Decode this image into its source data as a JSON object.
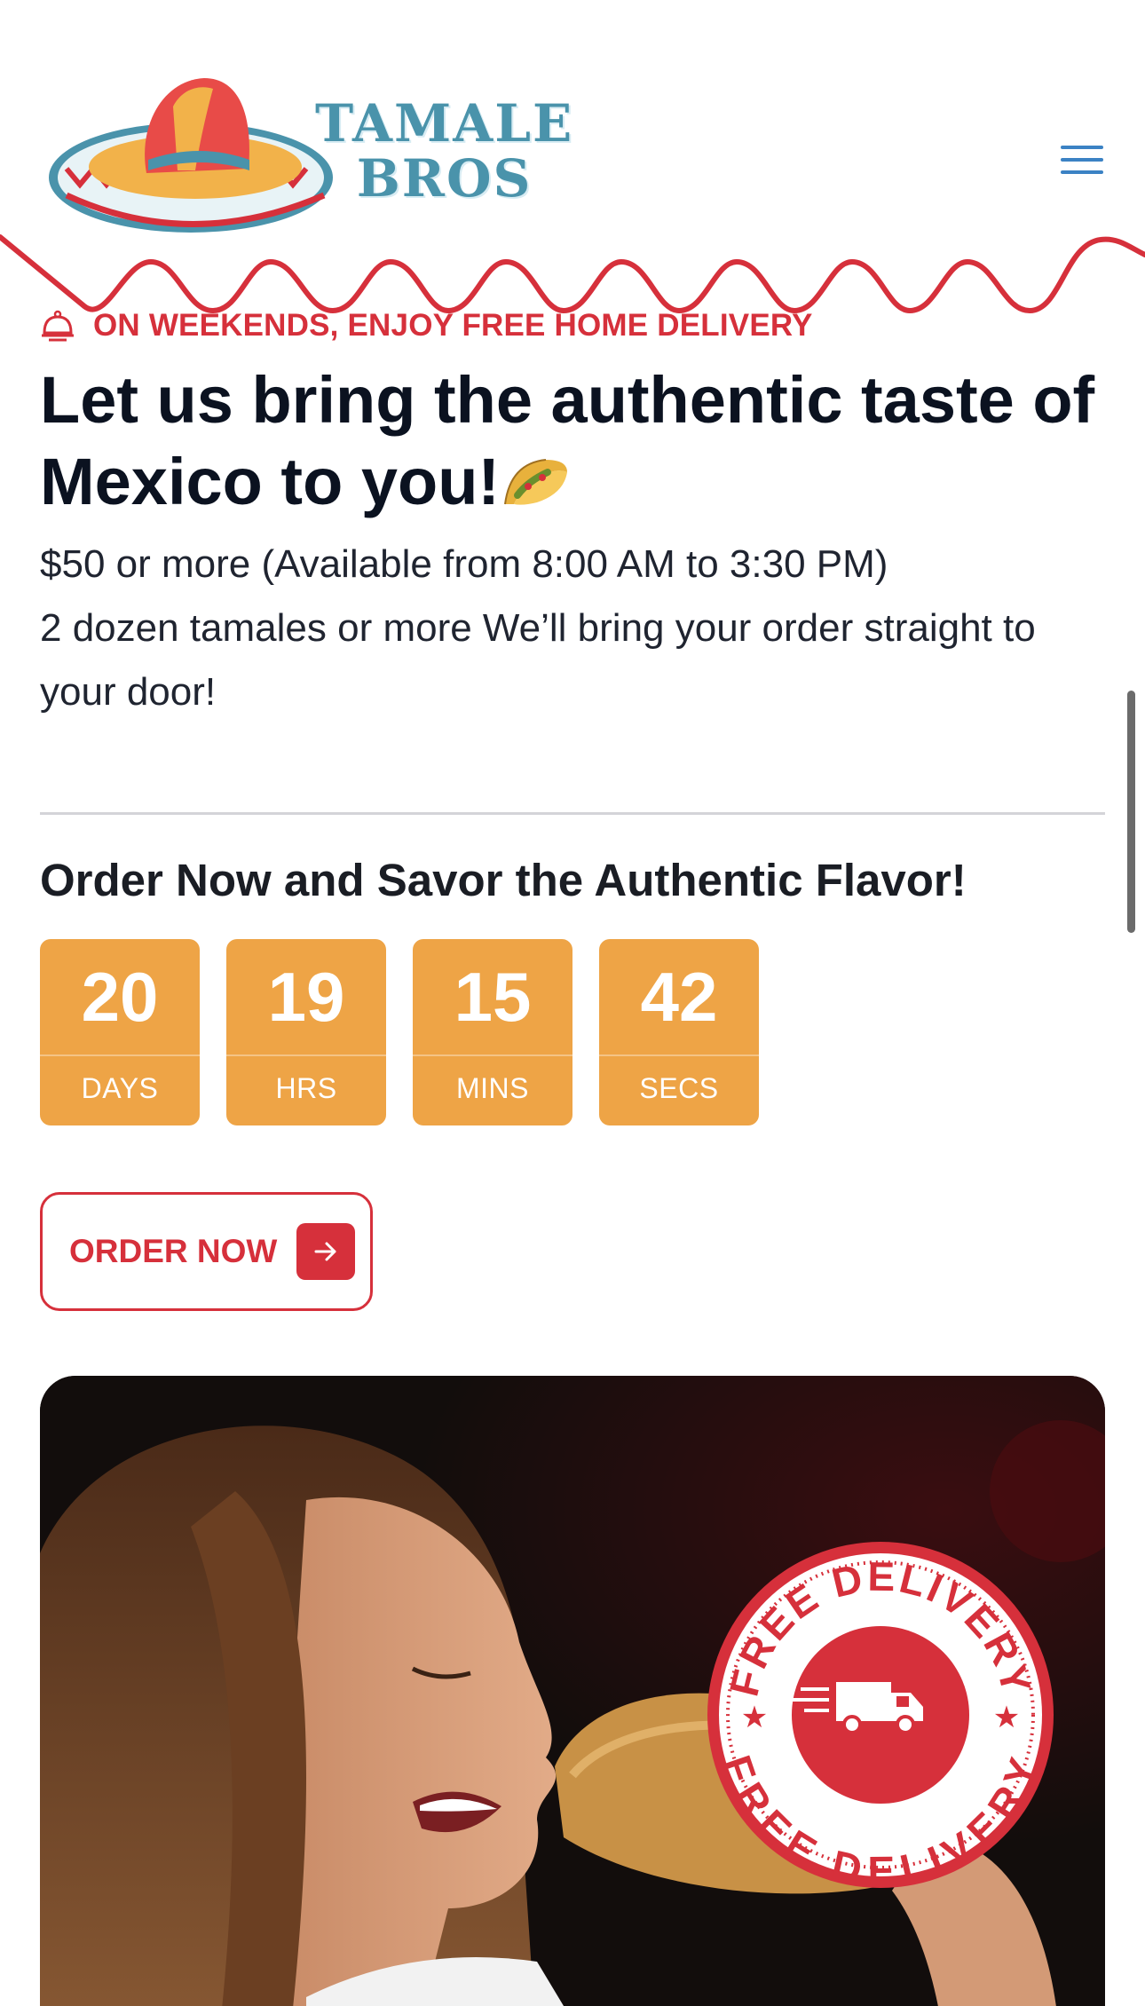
{
  "brand": {
    "line1": "TAMALE",
    "line2": "BROS"
  },
  "header": {
    "menu_icon": "hamburger-menu-icon"
  },
  "promo": {
    "eyebrow_icon": "serving-cloche-icon",
    "eyebrow": "ON WEEKENDS, ENJOY FREE HOME DELIVERY",
    "headline": "Let us bring the authentic taste of Mexico to you!",
    "headline_emoji": "taco-icon",
    "line1": "$50 or more (Available from 8:00 AM to 3:30 PM)",
    "line2": "2 dozen tamales or more We’ll bring your order straight to your door!"
  },
  "countdown": {
    "title": "Order Now and Savor the Authentic Flavor!",
    "units": [
      {
        "value": "20",
        "label": "DAYS"
      },
      {
        "value": "19",
        "label": "HRS"
      },
      {
        "value": "15",
        "label": "MINS"
      },
      {
        "value": "42",
        "label": "SECS"
      }
    ]
  },
  "cta": {
    "label": "ORDER NOW",
    "icon": "arrow-right-icon"
  },
  "hero": {
    "badge_top": "FREE DELIVERY",
    "badge_bottom": "FREE DELIVERY",
    "badge_icon": "delivery-truck-icon"
  },
  "colors": {
    "accent_red": "#d6303b",
    "countdown_orange": "#eea446",
    "logo_blue": "#4a93ab",
    "menu_blue": "#3b82c4"
  }
}
